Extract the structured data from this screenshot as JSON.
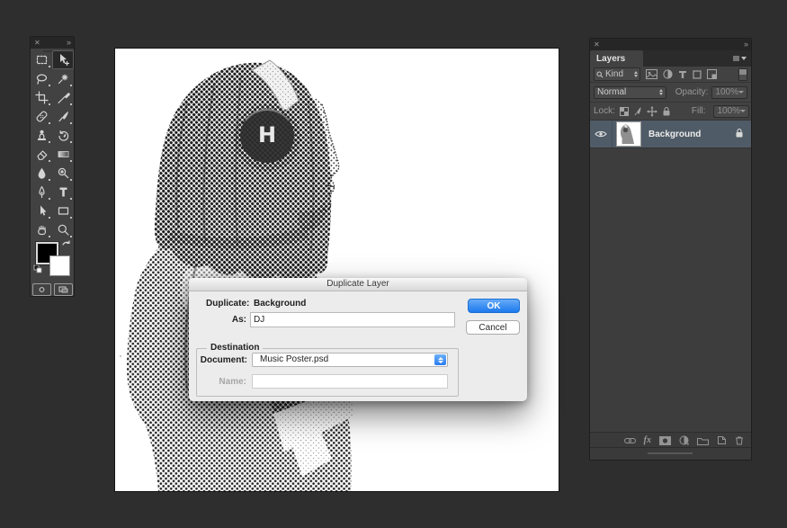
{
  "window": {
    "background": "#2e2e2e"
  },
  "toolbar": {
    "close_icon": "✕",
    "collapse_icon": "»",
    "tools": [
      {
        "name": "rectangular-marquee"
      },
      {
        "name": "move",
        "selected": true
      },
      {
        "name": "lasso"
      },
      {
        "name": "magic-wand"
      },
      {
        "name": "crop"
      },
      {
        "name": "eyedropper"
      },
      {
        "name": "healing-brush"
      },
      {
        "name": "brush"
      },
      {
        "name": "clone-stamp"
      },
      {
        "name": "history-brush"
      },
      {
        "name": "eraser"
      },
      {
        "name": "gradient"
      },
      {
        "name": "blur"
      },
      {
        "name": "dodge"
      },
      {
        "name": "pen"
      },
      {
        "name": "type"
      },
      {
        "name": "path-selection"
      },
      {
        "name": "rectangle-shape"
      },
      {
        "name": "hand"
      },
      {
        "name": "zoom"
      }
    ],
    "foreground_color": "#000000",
    "background_color": "#ffffff"
  },
  "canvas": {
    "image": "halftone-portrait-person-with-headphones",
    "headphone_letter": "H"
  },
  "dialog": {
    "title": "Duplicate Layer",
    "duplicate_label": "Duplicate:",
    "duplicate_value": "Background",
    "as_label": "As:",
    "as_value": "DJ",
    "ok_label": "OK",
    "cancel_label": "Cancel",
    "destination_legend": "Destination",
    "document_label": "Document:",
    "document_value": "Music Poster.psd",
    "name_label": "Name:",
    "name_value": ""
  },
  "layers_panel": {
    "close_icon": "✕",
    "collapse_icon": "»",
    "tab_label": "Layers",
    "filter": {
      "kind_label": "Kind"
    },
    "blend_mode": "Normal",
    "opacity_label": "Opacity:",
    "opacity_value": "100%",
    "lock_label": "Lock:",
    "fill_label": "Fill:",
    "fill_value": "100%",
    "layers": [
      {
        "name": "Background",
        "visible": true,
        "selected": true,
        "locked": true
      }
    ],
    "bottom_bar": {
      "fx_label": "fx"
    }
  },
  "colors": {
    "accent_blue": "#1f7fe8",
    "selection_row": "#4f5b66",
    "canvas_white": "#ffffff"
  }
}
